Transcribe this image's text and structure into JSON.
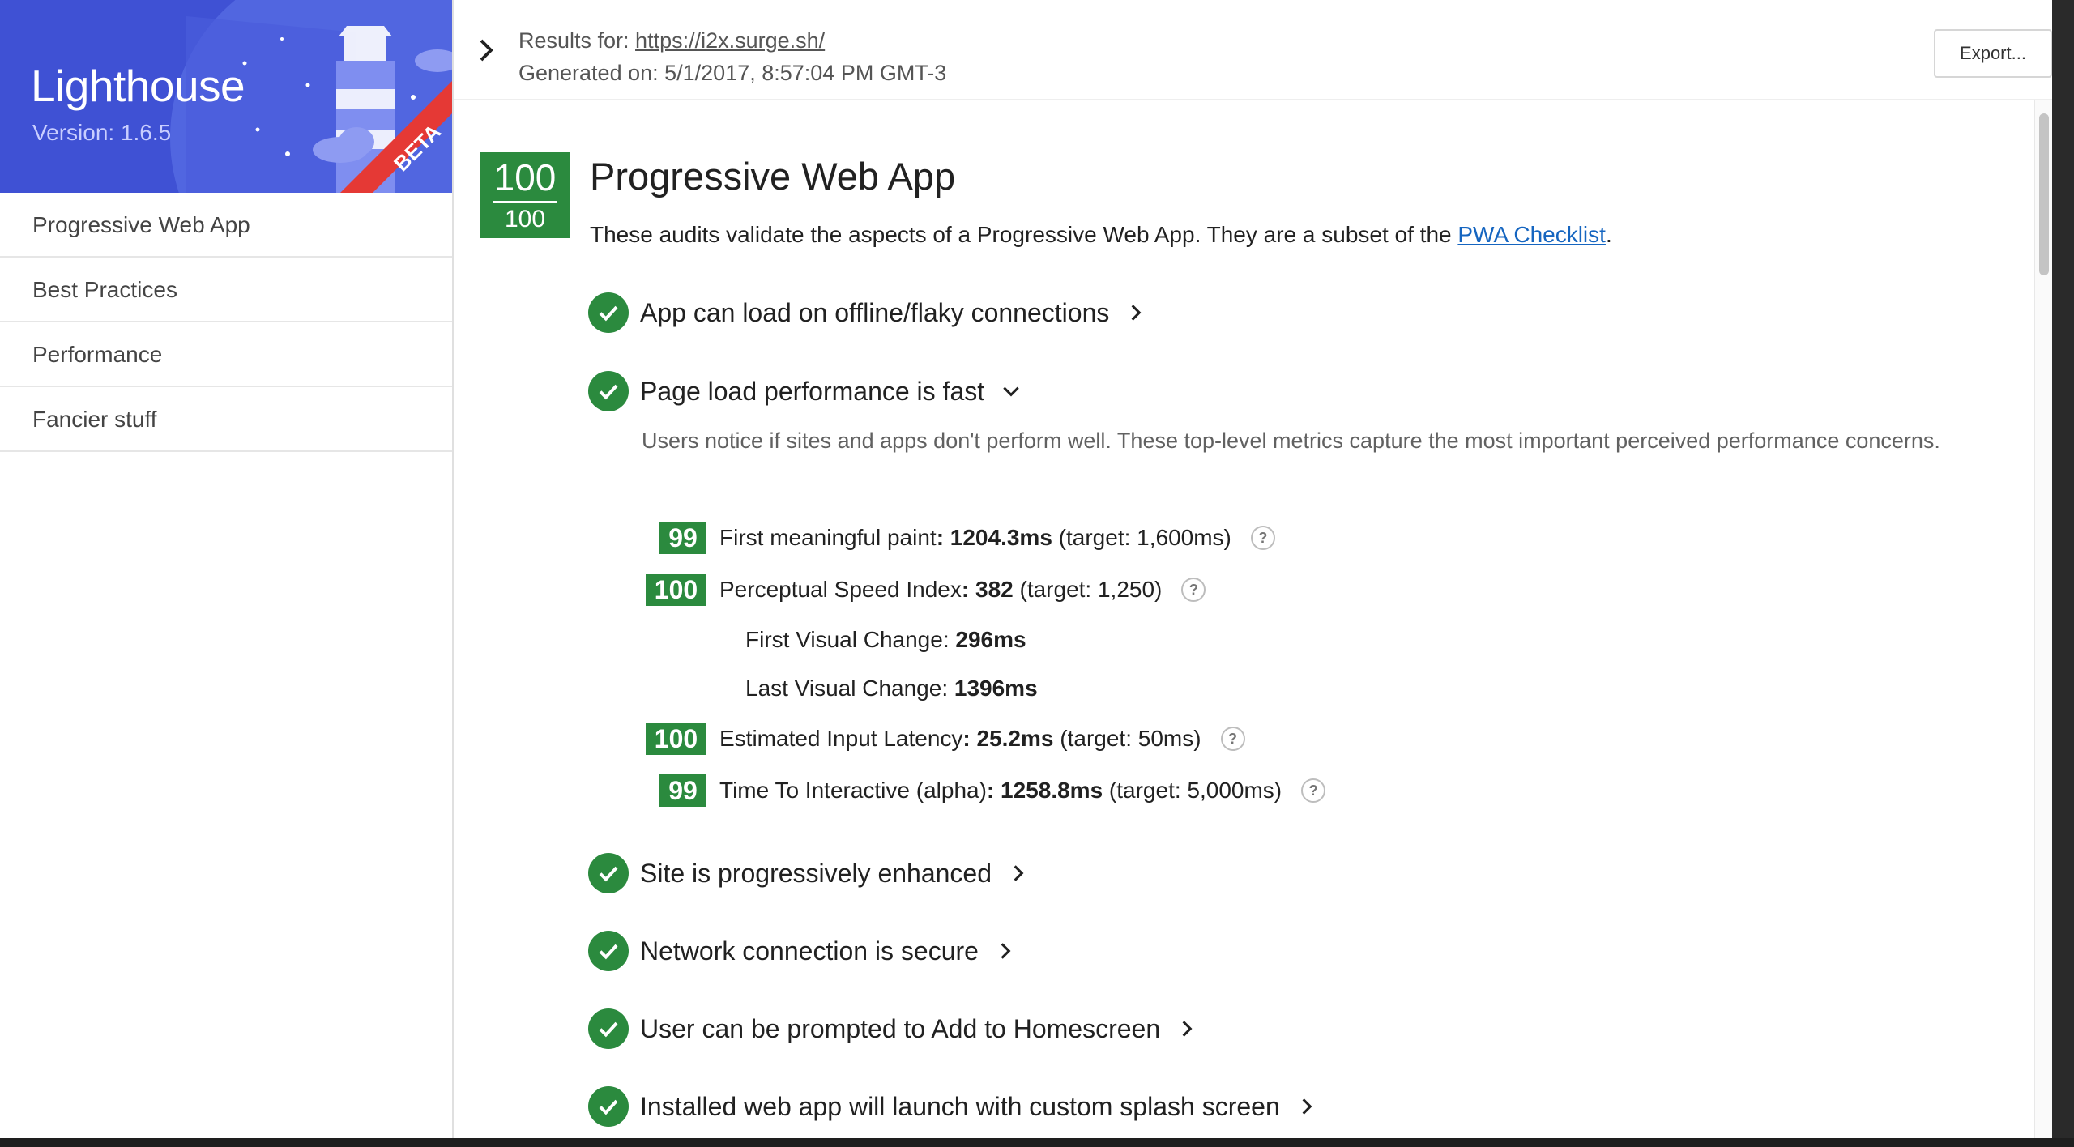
{
  "app": {
    "title": "Lighthouse",
    "version": "Version: 1.6.5",
    "badge": "BETA",
    "brand_color": "#3f51d4",
    "badge_color": "#e53935"
  },
  "sidebar": {
    "items": [
      {
        "label": "Progressive Web App"
      },
      {
        "label": "Best Practices"
      },
      {
        "label": "Performance"
      },
      {
        "label": "Fancier stuff"
      }
    ]
  },
  "topbar": {
    "results_prefix": "Results for: ",
    "url": "https://i2x.surge.sh/",
    "generated": "Generated on: 5/1/2017, 8:57:04 PM GMT-3",
    "export_label": "Export..."
  },
  "section": {
    "score": "100",
    "score_max": "100",
    "score_color": "#2b8a3e",
    "title": "Progressive Web App",
    "desc_prefix": "These audits validate the aspects of a Progressive Web App. They are a subset of the ",
    "desc_link": "PWA Checklist",
    "desc_suffix": "."
  },
  "audits": [
    {
      "label": "App can load on offline/flaky connections",
      "expanded": false,
      "icon": "chevron-right-icon"
    },
    {
      "label": "Page load performance is fast",
      "expanded": true,
      "icon": "chevron-down-icon"
    },
    {
      "label": "Site is progressively enhanced",
      "expanded": false,
      "icon": "chevron-right-icon"
    },
    {
      "label": "Network connection is secure",
      "expanded": false,
      "icon": "chevron-right-icon"
    },
    {
      "label": "User can be prompted to Add to Homescreen",
      "expanded": false,
      "icon": "chevron-right-icon"
    },
    {
      "label": "Installed web app will launch with custom splash screen",
      "expanded": false,
      "icon": "chevron-right-icon"
    }
  ],
  "perf": {
    "help": "Users notice if sites and apps don't perform well. These top-level metrics capture the most important perceived performance concerns.",
    "metrics": [
      {
        "score": "99",
        "name": "First meaningful paint",
        "value": ": 1204.3ms",
        "target": " (target: 1,600ms)"
      },
      {
        "score": "100",
        "name": "Perceptual Speed Index",
        "value": ": 382",
        "target": " (target: 1,250)"
      },
      {
        "score": "100",
        "name": "Estimated Input Latency",
        "value": ": 25.2ms",
        "target": " (target: 50ms)"
      },
      {
        "score": "99",
        "name": "Time To Interactive (alpha)",
        "value": ": 1258.8ms",
        "target": " (target: 5,000ms)"
      }
    ],
    "sub_metrics": [
      {
        "name": "First Visual Change: ",
        "value": "296ms"
      },
      {
        "name": "Last Visual Change: ",
        "value": "1396ms"
      }
    ],
    "help_glyph": "?"
  }
}
